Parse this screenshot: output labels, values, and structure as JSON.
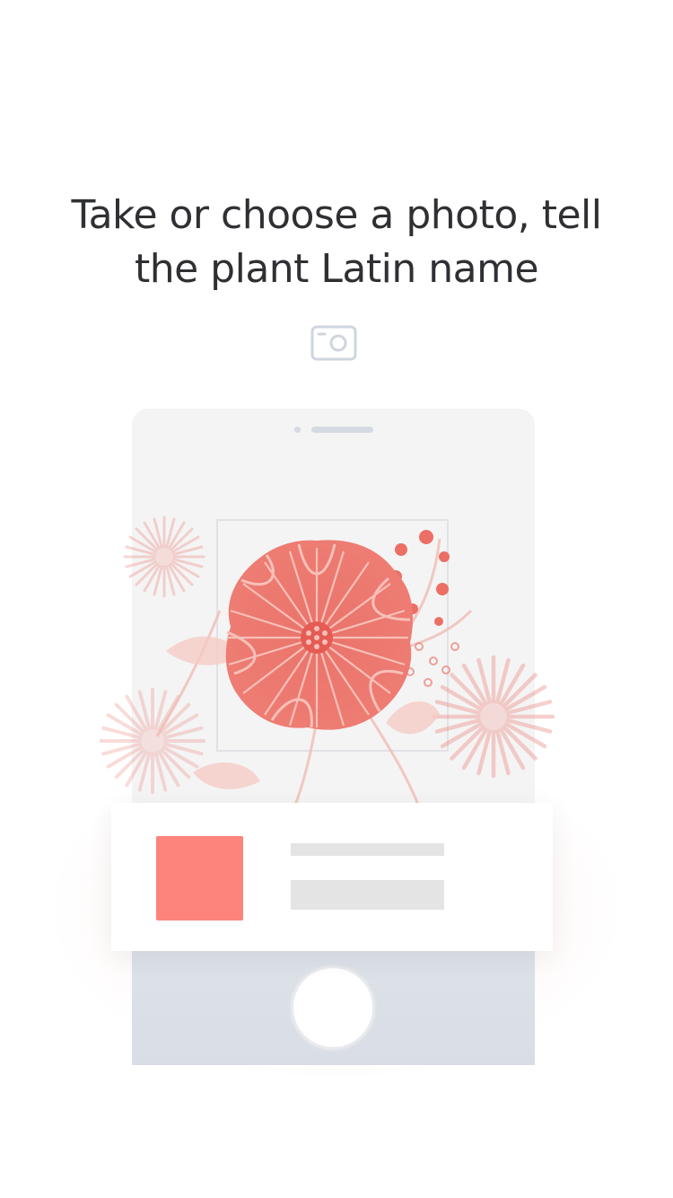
{
  "onboarding": {
    "headline_line1": "Take or choose a photo, tell",
    "headline_line2": "the plant Latin name"
  },
  "icons": {
    "camera": "camera-icon",
    "shutter": "shutter-button"
  },
  "colors": {
    "headline": "#2f3033",
    "accent": "#fc847c",
    "flower": "#ec6f66",
    "icon_gray": "#cfd5de",
    "phone_body": "#f4f4f4",
    "phone_bottom": "#dde1e8"
  }
}
